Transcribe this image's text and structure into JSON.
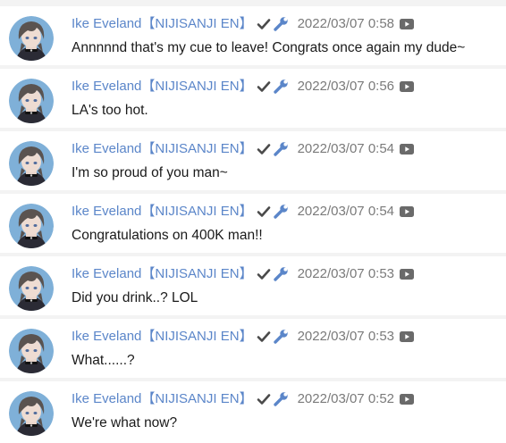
{
  "messages": [
    {
      "author": "Ike Eveland【NIJISANJI EN】",
      "timestamp": "2022/03/07 0:58",
      "text": "Annnnnd that's my cue to leave! Congrats once again my dude~"
    },
    {
      "author": "Ike Eveland【NIJISANJI EN】",
      "timestamp": "2022/03/07 0:56",
      "text": "LA's too hot."
    },
    {
      "author": "Ike Eveland【NIJISANJI EN】",
      "timestamp": "2022/03/07 0:54",
      "text": "I'm so proud of you man~"
    },
    {
      "author": "Ike Eveland【NIJISANJI EN】",
      "timestamp": "2022/03/07 0:54",
      "text": "Congratulations on 400K man!!"
    },
    {
      "author": "Ike Eveland【NIJISANJI EN】",
      "timestamp": "2022/03/07 0:53",
      "text": "Did you drink..? LOL"
    },
    {
      "author": "Ike Eveland【NIJISANJI EN】",
      "timestamp": "2022/03/07 0:53",
      "text": "What......?"
    },
    {
      "author": "Ike Eveland【NIJISANJI EN】",
      "timestamp": "2022/03/07 0:52",
      "text": "We're what now?"
    }
  ],
  "icons": {
    "verified": "check-icon",
    "moderator": "wrench-icon",
    "video": "youtube-play-icon"
  },
  "colors": {
    "author": "#5b86c9",
    "badge_check": "#4a4a4a",
    "badge_wrench": "#5b86c9",
    "timestamp": "#7a7a7a",
    "message_text": "#1a1a1a",
    "row_background": "#ffffff",
    "separator": "#f3f3f3"
  }
}
